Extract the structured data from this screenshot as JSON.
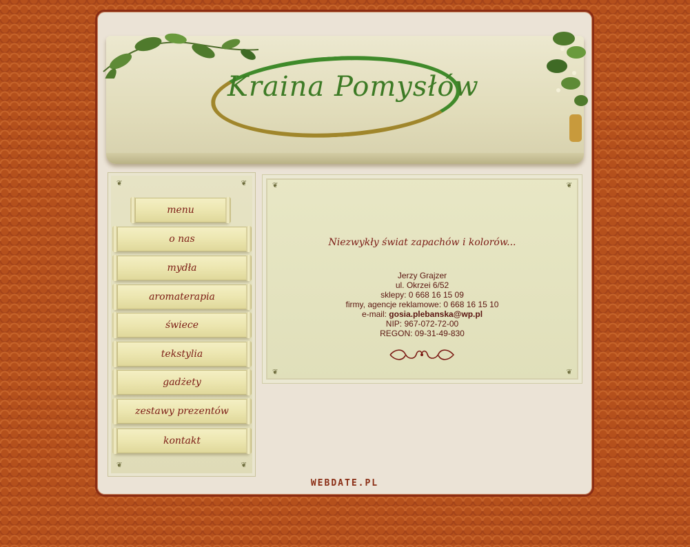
{
  "brand": {
    "logo_text": "Kraina Pomysłów"
  },
  "nav": {
    "items": [
      {
        "label": "menu"
      },
      {
        "label": "o nas"
      },
      {
        "label": "mydła"
      },
      {
        "label": "aromaterapia"
      },
      {
        "label": "świece"
      },
      {
        "label": "tekstylia"
      },
      {
        "label": "gadżety"
      },
      {
        "label": "zestawy prezentów"
      },
      {
        "label": "kontakt"
      }
    ]
  },
  "content": {
    "tagline": "Niezwykły świat zapachów i kolorów...",
    "contact": {
      "name": "Jerzy Grajzer",
      "address": "ul. Okrzei 6/52",
      "shops": "sklepy: 0 668 16 15 09",
      "companies": "firmy, agencje reklamowe: 0 668 16 15 10",
      "email_label": "e-mail: ",
      "email": "gosia.plebanska@wp.pl",
      "nip": "NIP: 967-072-72-00",
      "regon": "REGON: 09-31-49-830"
    }
  },
  "footer": {
    "credit": "WEBDATE.PL"
  },
  "colors": {
    "background": "#b5501c",
    "frame": "#8a2d14",
    "text_accent": "#7a1a14",
    "logo_green": "#3d7a25",
    "logo_gold": "#a0862b"
  },
  "icons": {
    "vines": "ivy-leaves-icon",
    "divider": "flourish-ornament-icon"
  }
}
